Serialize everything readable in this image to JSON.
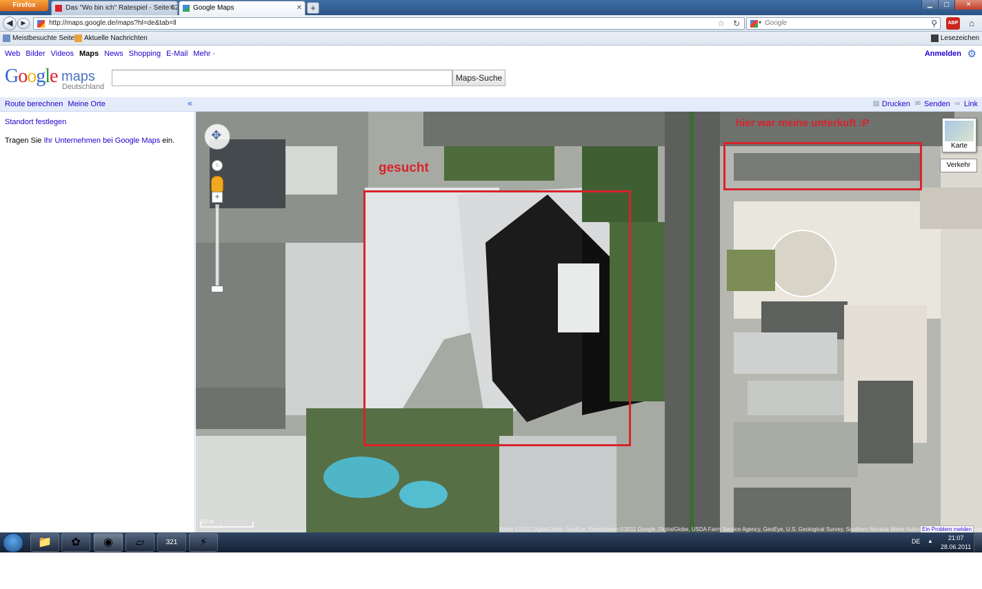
{
  "browser": {
    "menu_button": "Firefox",
    "tabs": [
      {
        "title": "Das \"Wo bin ich\" Ratespiel - Seite 62 ...",
        "active": false
      },
      {
        "title": "Google Maps",
        "active": true
      }
    ],
    "new_tab": "+",
    "url": "http://maps.google.de/maps?hl=de&tab=ll",
    "search_placeholder": "Google",
    "bookmarks": [
      "Meistbesuchte Seiten",
      "Aktuelle Nachrichten"
    ],
    "bookmarks_menu": "Lesezeichen",
    "abp_label": "ABP"
  },
  "google_bar": {
    "links": [
      "Web",
      "Bilder",
      "Videos",
      "Maps",
      "News",
      "Shopping",
      "E-Mail"
    ],
    "current": "Maps",
    "more": "Mehr ·",
    "sign_in": "Anmelden"
  },
  "logo": {
    "google": "Google",
    "maps": "maps",
    "country": "Deutschland"
  },
  "search": {
    "value": "",
    "button": "Maps-Suche"
  },
  "panel": {
    "route": "Route berechnen",
    "my_places": "Meine Orte",
    "collapse": "«",
    "set_location": "Standort festlegen",
    "business_prefix": "Tragen Sie ",
    "business_link": "Ihr Unternehmen bei Google Maps",
    "business_suffix": " ein."
  },
  "map_header": {
    "print": "Drucken",
    "send": "Senden",
    "link": "Link"
  },
  "map": {
    "type_button": "Karte",
    "traffic_button": "Verkehr",
    "scale": "50 m",
    "copyright": "Bilder ©2011 DigitalGlobe, GeoEye, Kartendaten ©2011 Google, DigitalGlobe, USDA Farm Service Agency, GeoEye, U.S. Geological Survey, Southern Nevada Water Authority - Nutzungsbedingungen",
    "report": "Ein Problem melden",
    "annotations": {
      "searched": "gesucht",
      "lodging": "hier war meine unterkuft :P"
    },
    "annotation_color": "#d8232a"
  },
  "taskbar": {
    "language": "DE",
    "time": "21:07",
    "date": "28.06.2011",
    "calendar_day": "321"
  }
}
